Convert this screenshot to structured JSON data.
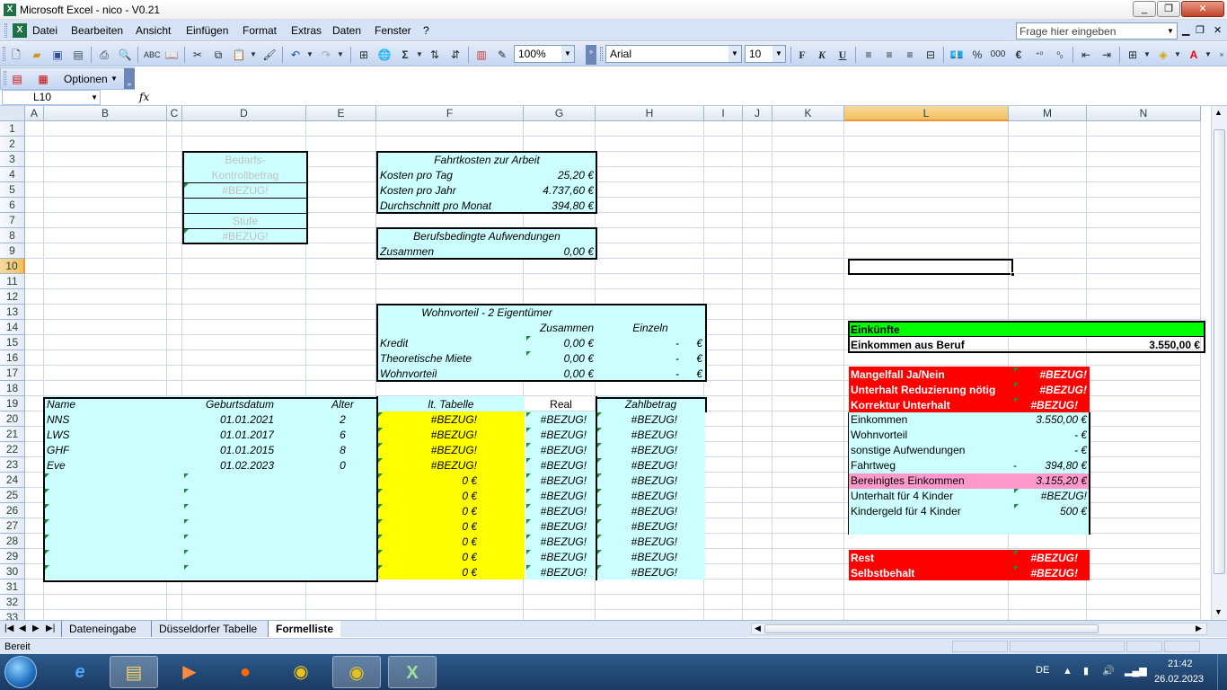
{
  "window": {
    "title": "Microsoft Excel - nico - V0.21"
  },
  "menu": {
    "items": [
      "Datei",
      "Bearbeiten",
      "Ansicht",
      "Einfügen",
      "Format",
      "Extras",
      "Daten",
      "Fenster",
      "?"
    ],
    "help_placeholder": "Frage hier eingeben"
  },
  "toolbar": {
    "zoom": "100%",
    "font": "Arial",
    "size": "10",
    "bold": "F",
    "italic": "K",
    "underline": "U",
    "percent": "%",
    "thousands": "000",
    "euro": "€",
    "sigma": "Σ"
  },
  "toolbar2": {
    "options_label": "Optionen"
  },
  "formula": {
    "namebox": "L10",
    "fx": "fx",
    "content": ""
  },
  "columns": [
    "A",
    "B",
    "C",
    "D",
    "E",
    "F",
    "G",
    "H",
    "I",
    "J",
    "K",
    "L",
    "M",
    "N"
  ],
  "rows": [
    "1",
    "2",
    "3",
    "4",
    "5",
    "6",
    "7",
    "8",
    "9",
    "10",
    "11",
    "12",
    "13",
    "14",
    "15",
    "16",
    "17",
    "18",
    "19",
    "20",
    "21",
    "22",
    "23",
    "24",
    "25",
    "26",
    "27",
    "28",
    "29",
    "30",
    "31",
    "32",
    "33"
  ],
  "bedarf": {
    "l1": "Bedarfs-",
    "l2": "Kontrollbetrag",
    "v1": "#BEZUG!",
    "l3": "Stufe",
    "v2": "#BEZUG!"
  },
  "fahrt": {
    "title": "Fahrtkosten zur Arbeit",
    "r1l": "Kosten pro Tag",
    "r1v": "25,20 €",
    "r2l": "Kosten pro Jahr",
    "r2v": "4.737,60 €",
    "r3l": "Durchschnitt pro Monat",
    "r3v": "394,80 €"
  },
  "beruf": {
    "title": "Berufsbedingte Aufwendungen",
    "r1l": "Zusammen",
    "r1v": "0,00 €"
  },
  "wohn": {
    "title": "Wohnvorteil - 2 Eigentümer",
    "h1": "Zusammen",
    "h2": "Einzeln",
    "rows": [
      {
        "l": "Kredit",
        "z": "0,00 €",
        "e": "-",
        "eur": "€"
      },
      {
        "l": "Theoretische Miete",
        "z": "0,00 €",
        "e": "-",
        "eur": "€"
      },
      {
        "l": "Wohnvorteil",
        "z": "0,00 €",
        "e": "-",
        "eur": "€"
      }
    ]
  },
  "kinder": {
    "h_name": "Name",
    "h_geb": "Geburtsdatum",
    "h_alter": "Alter",
    "h_tab": "lt. Tabelle",
    "h_real": "Real",
    "h_zahl": "Zahlbetrag",
    "rows": [
      {
        "name": "NNS",
        "geb": "01.01.2021",
        "alter": "2",
        "tab": "#BEZUG!",
        "real": "#BEZUG!",
        "zahl": "#BEZUG!"
      },
      {
        "name": "LWS",
        "geb": "01.01.2017",
        "alter": "6",
        "tab": "#BEZUG!",
        "real": "#BEZUG!",
        "zahl": "#BEZUG!"
      },
      {
        "name": "GHF",
        "geb": "01.01.2015",
        "alter": "8",
        "tab": "#BEZUG!",
        "real": "#BEZUG!",
        "zahl": "#BEZUG!"
      },
      {
        "name": "Eve",
        "geb": "01.02.2023",
        "alter": "0",
        "tab": "#BEZUG!",
        "real": "#BEZUG!",
        "zahl": "#BEZUG!"
      },
      {
        "name": "",
        "geb": "",
        "alter": "",
        "tab": "0 €",
        "real": "#BEZUG!",
        "zahl": "#BEZUG!"
      },
      {
        "name": "",
        "geb": "",
        "alter": "",
        "tab": "0 €",
        "real": "#BEZUG!",
        "zahl": "#BEZUG!"
      },
      {
        "name": "",
        "geb": "",
        "alter": "",
        "tab": "0 €",
        "real": "#BEZUG!",
        "zahl": "#BEZUG!"
      },
      {
        "name": "",
        "geb": "",
        "alter": "",
        "tab": "0 €",
        "real": "#BEZUG!",
        "zahl": "#BEZUG!"
      },
      {
        "name": "",
        "geb": "",
        "alter": "",
        "tab": "0 €",
        "real": "#BEZUG!",
        "zahl": "#BEZUG!"
      },
      {
        "name": "",
        "geb": "",
        "alter": "",
        "tab": "0 €",
        "real": "#BEZUG!",
        "zahl": "#BEZUG!"
      },
      {
        "name": "",
        "geb": "",
        "alter": "",
        "tab": "0 €",
        "real": "#BEZUG!",
        "zahl": "#BEZUG!"
      }
    ]
  },
  "einkuenfte": {
    "title": "Einkünfte",
    "r1l": "Einkommen aus Beruf",
    "r1v": "3.550,00 €"
  },
  "mangel": {
    "r1l": "Mangelfall Ja/Nein",
    "r1v": "#BEZUG!",
    "r2l": "Unterhalt Reduzierung nötig",
    "r2v": "#BEZUG!",
    "r3l": "Korrektur Unterhalt",
    "r3v": "#BEZUG!"
  },
  "calc": {
    "rows": [
      {
        "l": "Einkommen",
        "pre": "",
        "v": "3.550,00 €"
      },
      {
        "l": "Wohnvorteil",
        "pre": "",
        "v": "-   €"
      },
      {
        "l": "sonstige Aufwendungen",
        "pre": "",
        "v": "-   €"
      },
      {
        "l": "Fahrtweg",
        "pre": "-",
        "v": "394,80 €"
      },
      {
        "l": "Bereinigtes Einkommen",
        "pre": "",
        "v": "3.155,20 €"
      },
      {
        "l": "Unterhalt für 4 Kinder",
        "pre": "",
        "v": "#BEZUG!"
      },
      {
        "l": "Kindergeld für 4 Kinder",
        "pre": "",
        "v": "500 €"
      }
    ]
  },
  "rest": {
    "r1l": "Rest",
    "r1v": "#BEZUG!",
    "r2l": "Selbstbehalt",
    "r2v": "#BEZUG!"
  },
  "tabs": [
    "Dateneingabe",
    "Düsseldorfer Tabelle",
    "Formelliste"
  ],
  "status": {
    "text": "Bereit"
  },
  "tray": {
    "lang": "DE",
    "time": "21:42",
    "date": "26.02.2023"
  },
  "colors": {
    "cyan": "#ccffff",
    "yellow": "#ffff00",
    "red": "#ff0000",
    "green": "#00ff00",
    "pink": "#ff99cc",
    "header": "#dfe7f2",
    "selected": "#f9d99f"
  }
}
